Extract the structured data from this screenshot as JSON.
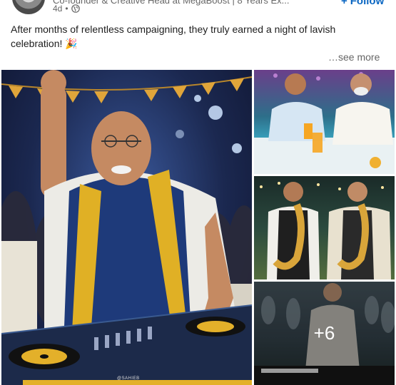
{
  "author": {
    "headline": "Co-founder & Creative Head at MegaBoost | 8 Years Ex...",
    "time_ago": "4d",
    "separator": "•",
    "visibility_icon": "globe-icon"
  },
  "follow": {
    "label": "Follow",
    "icon": "plus-icon"
  },
  "post": {
    "text": "After months of relentless campaigning, they truly earned a night of lavish celebration! 🎉",
    "see_more": "…see more"
  },
  "gallery": {
    "images": [
      {
        "name": "dj-celebration-image"
      },
      {
        "name": "poolside-drinks-image"
      },
      {
        "name": "saxophone-duo-image"
      },
      {
        "name": "piano-performance-image"
      }
    ],
    "more_count": "+6",
    "watermark": "@SAHIEB"
  },
  "colors": {
    "link": "#0a66c2",
    "text": "#1d1d1d",
    "muted": "#666666"
  }
}
